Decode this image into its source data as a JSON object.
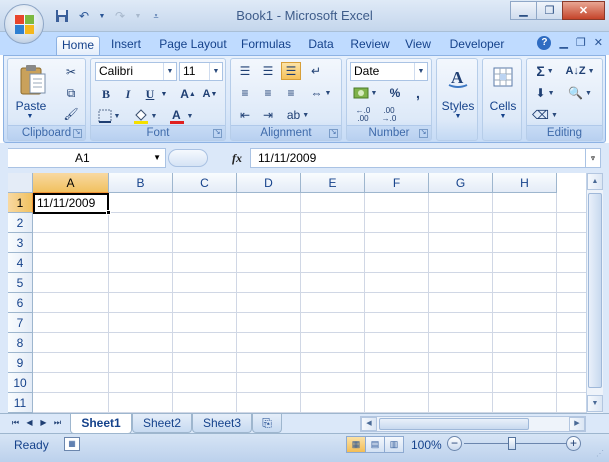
{
  "window": {
    "title": "Book1 - Microsoft Excel",
    "controls": [
      "minimize",
      "restore",
      "close"
    ]
  },
  "quick_access": {
    "icons": [
      "save-icon",
      "undo-icon",
      "redo-icon",
      "customize-icon"
    ]
  },
  "ribbon": {
    "tabs": [
      {
        "label": "Home",
        "active": true
      },
      {
        "label": "Insert"
      },
      {
        "label": "Page Layout"
      },
      {
        "label": "Formulas"
      },
      {
        "label": "Data"
      },
      {
        "label": "Review"
      },
      {
        "label": "View"
      },
      {
        "label": "Developer"
      }
    ],
    "groups": {
      "clipboard": {
        "label": "Clipboard",
        "paste_label": "Paste"
      },
      "font": {
        "label": "Font",
        "font_name": "Calibri",
        "font_size": "11",
        "bold": "B",
        "italic": "I",
        "underline": "U"
      },
      "alignment": {
        "label": "Alignment"
      },
      "number": {
        "label": "Number",
        "format": "Date",
        "percent": "%",
        "comma": ","
      },
      "styles": {
        "label": "Styles"
      },
      "cells": {
        "label": "Cells"
      },
      "editing": {
        "label": "Editing"
      }
    }
  },
  "formula_bar": {
    "name_box": "A1",
    "fx_label": "fx",
    "formula": "11/11/2009"
  },
  "grid": {
    "columns": [
      "A",
      "B",
      "C",
      "D",
      "E",
      "F",
      "G",
      "H"
    ],
    "rows": [
      "1",
      "2",
      "3",
      "4",
      "5",
      "6",
      "7",
      "8",
      "9",
      "10",
      "11"
    ],
    "selected_cell": "A1",
    "a1_value": "11/11/2009"
  },
  "sheets": {
    "tabs": [
      "Sheet1",
      "Sheet2",
      "Sheet3"
    ],
    "active": "Sheet1"
  },
  "status_bar": {
    "status": "Ready",
    "zoom": "100%"
  },
  "colors": {
    "ribbon_bg": "#dbe8f9",
    "selection_header": "#f1c15f",
    "text_blue": "#15428b",
    "font_color_accent": "#e02020",
    "highlight_accent": "#f5e000"
  }
}
